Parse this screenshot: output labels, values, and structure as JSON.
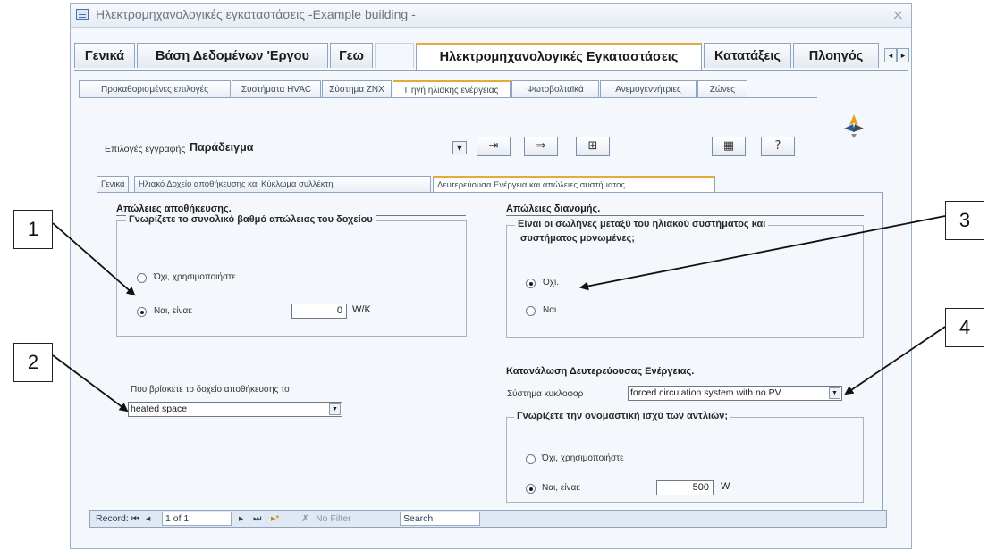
{
  "window": {
    "title": "Ηλεκτρομηχανολογικές εγκαταστάσεις -Example building -",
    "close": "×"
  },
  "main_tabs": [
    {
      "label": "Γενικά"
    },
    {
      "label": "Βάση Δεδομένων 'Εργου"
    },
    {
      "label": "Γεω"
    },
    {
      "label": ""
    },
    {
      "label": "Ηλεκτρομηχανολογικές Εγκαταστάσεις"
    },
    {
      "label": "Κατατάξεις"
    },
    {
      "label": "Πλοηγός"
    }
  ],
  "tab_scroll": {
    "left": "◂",
    "right": "▸"
  },
  "sub_tabs": [
    {
      "label": "Προκαθορισμένες επιλογές"
    },
    {
      "label": "Συστήματα HVAC"
    },
    {
      "label": "Σύστημα ΖΝΧ"
    },
    {
      "label": "Πηγή ηλιακής ενέργειας"
    },
    {
      "label": "Φωτοβολταϊκά"
    },
    {
      "label": "Ανεμογεννήτριες"
    },
    {
      "label": "Ζώνες"
    }
  ],
  "record_options": {
    "label": "Επιλογές εγγραφής",
    "value": "Παράδειγμα",
    "dropdown": "▼"
  },
  "toolbar_buttons": [
    {
      "icon": "import-icon",
      "glyph": "⇥"
    },
    {
      "icon": "export-icon",
      "glyph": "⇒"
    },
    {
      "icon": "tree-icon",
      "glyph": "⊞"
    },
    {
      "icon": "form-icon",
      "glyph": "▦"
    },
    {
      "icon": "help-icon",
      "glyph": "?"
    }
  ],
  "inner_tabs": [
    {
      "label": "Γενικά"
    },
    {
      "label": "Ηλιακό Δοχείο αποθήκευσης και Κύκλωμα συλλέκτη"
    },
    {
      "label": "Δευτερεύουσα Ενέργεια και απώλειες συστήματος"
    }
  ],
  "storage_losses": {
    "heading": "Απώλειες αποθήκευσης.",
    "group_label": "Γνωρίζετε το συνολικό βαθμό απώλειας του δοχείου",
    "option_no": "Όχι, χρησιμοποιήστε",
    "option_yes": "Ναι, είναι:",
    "value": "0",
    "unit": "W/K"
  },
  "tank_location": {
    "label": "Που βρίσκετε το δοχείο αποθήκευσης το",
    "value": "heated space"
  },
  "distribution_losses": {
    "heading": "Απώλειες διανομής.",
    "question_line1": "Είναι οι σωλήνες μεταξύ του ηλιακού συστήματος και",
    "question_line2": "συστήματος μονωμένες;",
    "option_no": "Όχι.",
    "option_yes": "Ναι."
  },
  "secondary_energy": {
    "heading": "Κατανάλωση Δευτερεύουσας Ενέργειας.",
    "system_label": "Σύστημα κυκλοφορ",
    "system_value": "forced circulation system with no PV",
    "group_label": "Γνωρίζετε την ονομαστική ισχύ των αντλιών;",
    "option_no": "Όχι, χρησιμοποιήστε",
    "option_yes": "Ναι, είναι:",
    "value": "500",
    "unit": "W"
  },
  "record_nav": {
    "label": "Record:",
    "first": "⏮",
    "prev": "◂",
    "position": "1 of 1",
    "next": "▸",
    "last": "⏭",
    "new": "▸*",
    "filter": "No Filter",
    "search": "Search"
  },
  "callouts": [
    "1",
    "2",
    "3",
    "4"
  ]
}
